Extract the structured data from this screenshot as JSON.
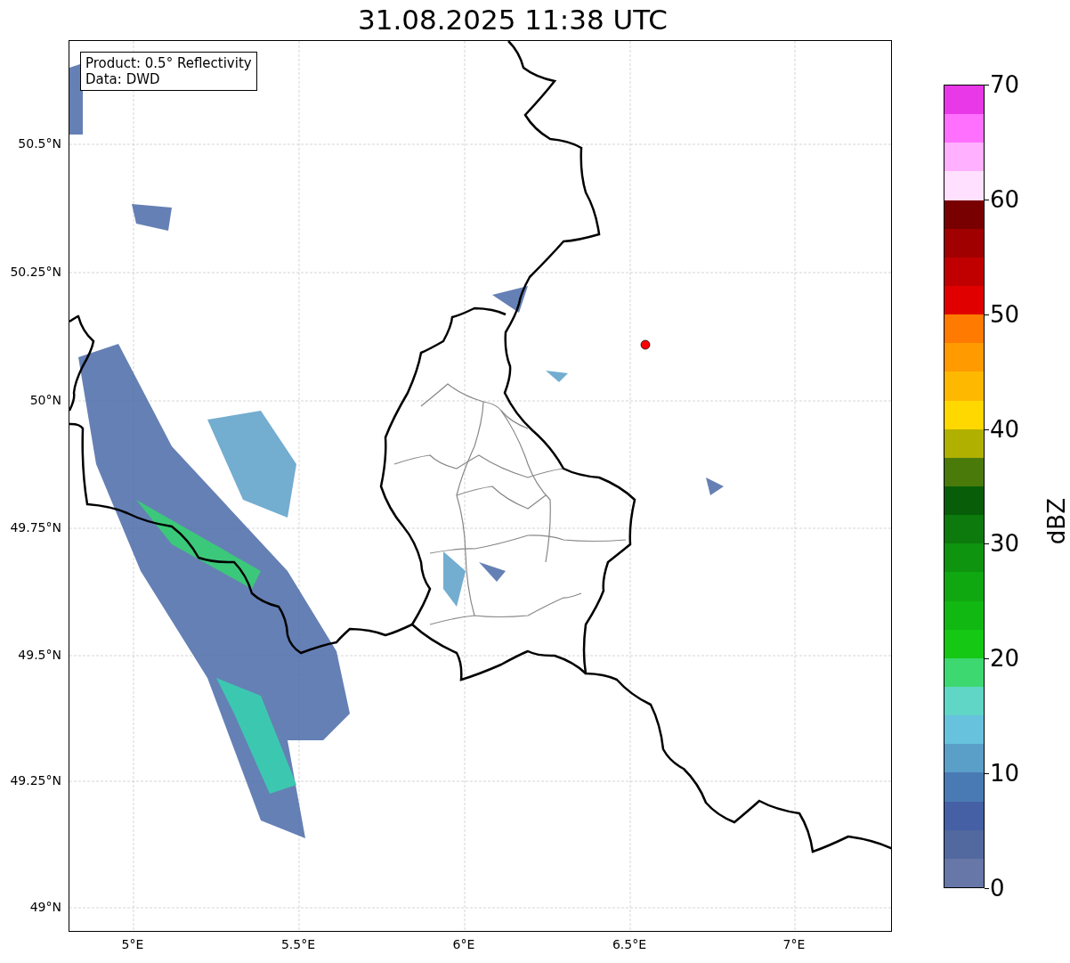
{
  "title": "31.08.2025 11:38 UTC",
  "map": {
    "info_lines": [
      "Product: 0.5° Reflectivity",
      "Data: DWD"
    ],
    "lat_ticks": [
      "50.5°N",
      "50.25°N",
      "50°N",
      "49.75°N",
      "49.5°N",
      "49.25°N",
      "49°N"
    ],
    "lon_ticks": [
      "5°E",
      "5.5°E",
      "6°E",
      "6.5°E",
      "7°E"
    ]
  },
  "colorbar": {
    "label": "dBZ",
    "ticks": [
      "70",
      "60",
      "50",
      "40",
      "30",
      "20",
      "10",
      "0"
    ],
    "segments": [
      {
        "color": "#e838e8"
      },
      {
        "color": "#ff70ff"
      },
      {
        "color": "#ffb0ff"
      },
      {
        "color": "#ffe0ff"
      },
      {
        "color": "#780000"
      },
      {
        "color": "#a00000"
      },
      {
        "color": "#c00000"
      },
      {
        "color": "#e00000"
      },
      {
        "color": "#ff7a00"
      },
      {
        "color": "#ff9a00"
      },
      {
        "color": "#ffb800"
      },
      {
        "color": "#ffd800"
      },
      {
        "color": "#b0b000"
      },
      {
        "color": "#4a7a0a"
      },
      {
        "color": "#085e08"
      },
      {
        "color": "#0c7a0c"
      },
      {
        "color": "#0e940e"
      },
      {
        "color": "#10a810"
      },
      {
        "color": "#12b812"
      },
      {
        "color": "#14c814"
      },
      {
        "color": "#3dd870"
      },
      {
        "color": "#60d6c6"
      },
      {
        "color": "#66c2dd"
      },
      {
        "color": "#5a9fc8"
      },
      {
        "color": "#4a7ab3"
      },
      {
        "color": "#4560a5"
      },
      {
        "color": "#52699f"
      },
      {
        "color": "#6677a8"
      }
    ]
  }
}
